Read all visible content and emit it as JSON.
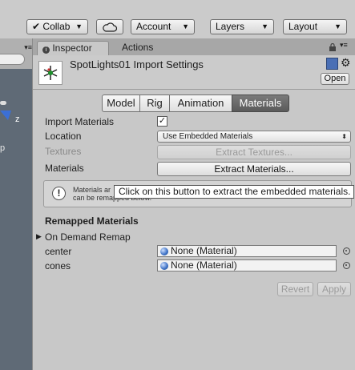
{
  "toolbar": {
    "collab_label": "Collab",
    "account_label": "Account",
    "layers_label": "Layers",
    "layout_label": "Layout"
  },
  "side": {
    "axis_label": "z",
    "partial_text": "p"
  },
  "tabs": {
    "inspector": "Inspector",
    "actions": "Actions"
  },
  "header": {
    "title": "SpotLights01 Import Settings",
    "open_label": "Open"
  },
  "importer_tabs": [
    "Model",
    "Rig",
    "Animation",
    "Materials"
  ],
  "fields": {
    "import_materials_label": "Import Materials",
    "location_label": "Location",
    "location_value": "Use Embedded Materials",
    "textures_label": "Textures",
    "extract_textures_label": "Extract Textures...",
    "materials_label": "Materials",
    "extract_materials_label": "Extract Materials..."
  },
  "help": {
    "line1": "Materials ar",
    "line2": "can be remapped below."
  },
  "tooltip": "Click on this button to extract the embedded materials.",
  "remapped": {
    "heading": "Remapped Materials",
    "on_demand": "On Demand Remap",
    "rows": [
      {
        "label": "center",
        "value": "None (Material)"
      },
      {
        "label": "cones",
        "value": "None (Material)"
      }
    ]
  },
  "actions": {
    "revert": "Revert",
    "apply": "Apply"
  }
}
